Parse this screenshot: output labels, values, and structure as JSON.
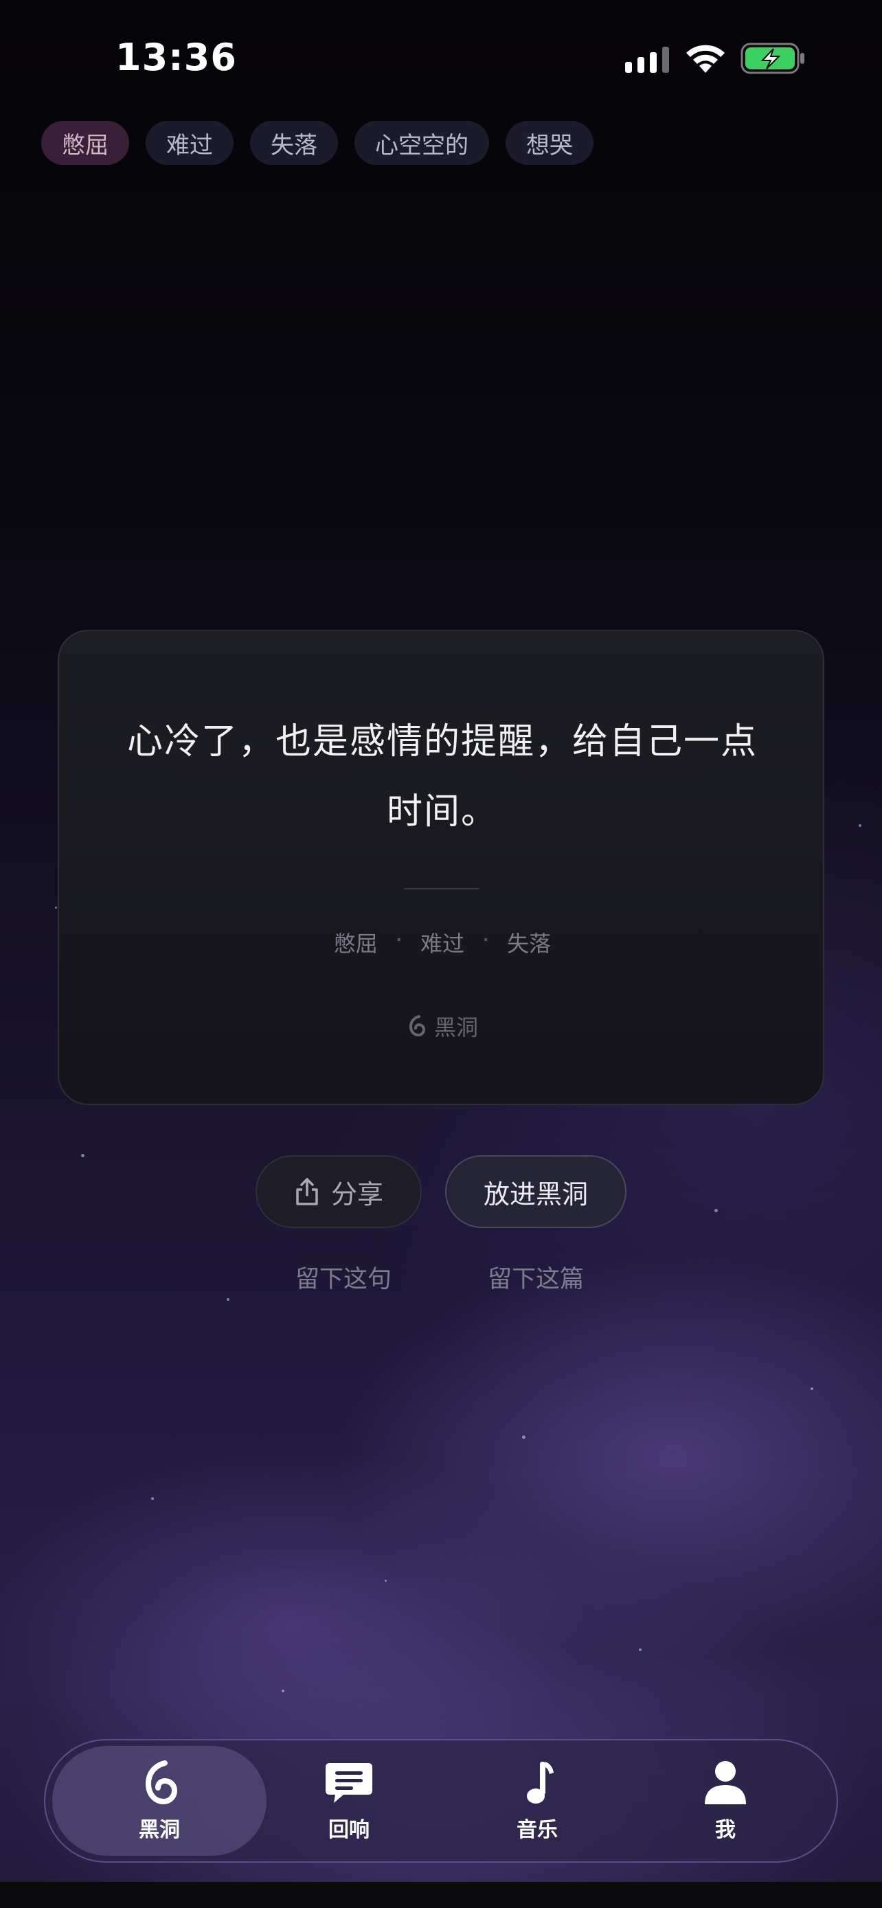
{
  "status_bar": {
    "time": "13:36"
  },
  "mood_tags": [
    "憋屈",
    "难过",
    "失落",
    "心空空的",
    "想哭"
  ],
  "card": {
    "quote": "心冷了，也是感情的提醒，给自己一点时间。",
    "tags": [
      "憋屈",
      "难过",
      "失落"
    ],
    "separator": "·",
    "brand": "黑洞"
  },
  "actions": {
    "share": "分享",
    "put_in_blackhole": "放进黑洞",
    "keep_sentence": "留下这句",
    "keep_article": "留下这篇"
  },
  "tabbar": {
    "tabs": [
      {
        "label": "黑洞",
        "icon": "blackhole-icon",
        "selected": true
      },
      {
        "label": "回响",
        "icon": "message-icon",
        "selected": false
      },
      {
        "label": "音乐",
        "icon": "music-note-icon",
        "selected": false
      },
      {
        "label": "我",
        "icon": "person-icon",
        "selected": false
      }
    ]
  },
  "colors": {
    "accent": "#b9a8f0",
    "active_tag_bg": "#3a1f36",
    "card_bg": "#1a1a21"
  }
}
